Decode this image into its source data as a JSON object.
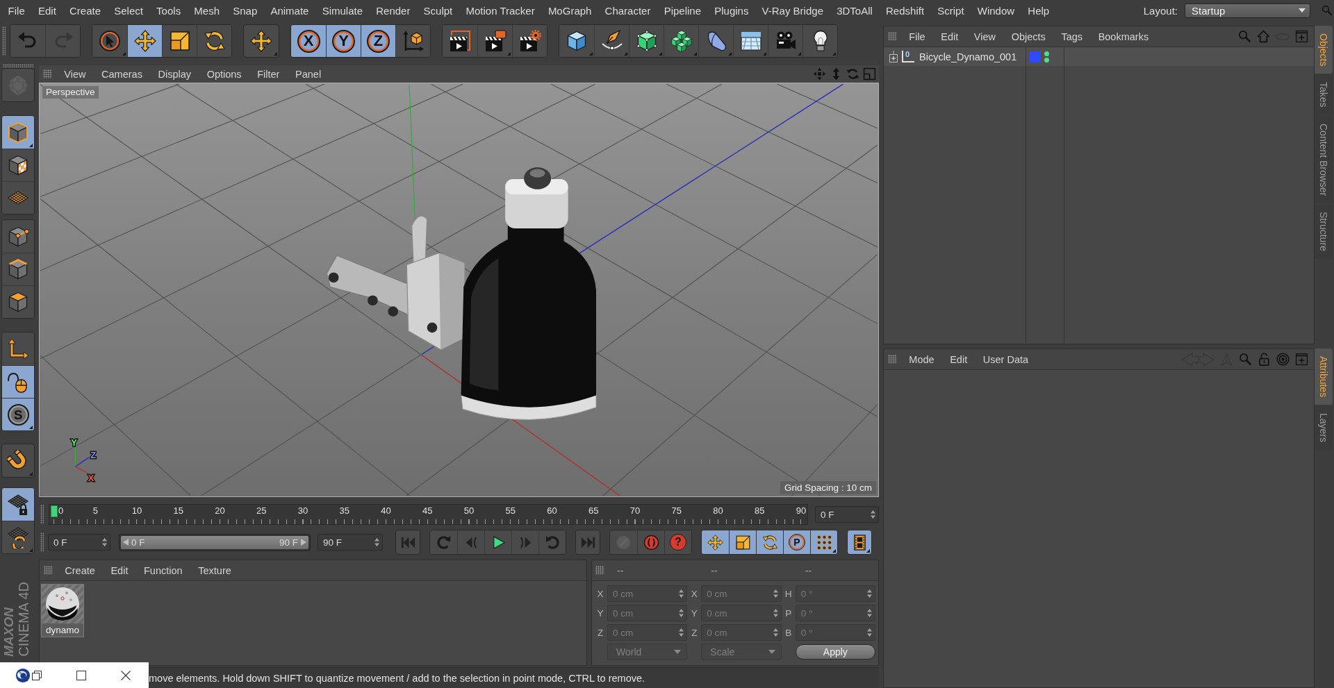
{
  "menu_bar": {
    "items": [
      "File",
      "Edit",
      "Create",
      "Select",
      "Tools",
      "Mesh",
      "Snap",
      "Animate",
      "Simulate",
      "Render",
      "Sculpt",
      "Motion Tracker",
      "MoGraph",
      "Character",
      "Pipeline",
      "Plugins",
      "V-Ray Bridge",
      "3DToAll",
      "Redshift",
      "Script",
      "Window",
      "Help"
    ],
    "layout_label": "Layout:",
    "layout_value": "Startup"
  },
  "toolbar": [
    [
      {
        "kind": "undo",
        "selected": false,
        "disabled": false,
        "menu": false
      },
      {
        "kind": "redo",
        "selected": false,
        "disabled": true,
        "menu": false
      }
    ],
    [
      {
        "kind": "select",
        "selected": false,
        "disabled": false,
        "menu": true
      },
      {
        "kind": "move",
        "selected": true,
        "disabled": false,
        "menu": false
      },
      {
        "kind": "scale",
        "selected": false,
        "disabled": false,
        "menu": false
      },
      {
        "kind": "rotate",
        "selected": false,
        "disabled": false,
        "menu": false
      }
    ],
    [
      {
        "kind": "transform",
        "selected": false,
        "disabled": false,
        "menu": true
      }
    ],
    [
      {
        "kind": "xaxis",
        "label": "X",
        "selected": true,
        "disabled": false,
        "menu": false
      },
      {
        "kind": "yaxis",
        "label": "Y",
        "selected": true,
        "disabled": false,
        "menu": false
      },
      {
        "kind": "zaxis",
        "label": "Z",
        "selected": true,
        "disabled": false,
        "menu": false
      },
      {
        "kind": "coords",
        "selected": false,
        "disabled": false,
        "menu": false
      }
    ],
    [
      {
        "kind": "renderview",
        "selected": false,
        "disabled": false,
        "menu": false
      },
      {
        "kind": "render",
        "selected": false,
        "disabled": false,
        "menu": true
      },
      {
        "kind": "rendersettings",
        "selected": false,
        "disabled": false,
        "menu": false
      }
    ],
    [
      {
        "kind": "cube",
        "selected": false,
        "disabled": false,
        "menu": true
      },
      {
        "kind": "pen",
        "selected": false,
        "disabled": false,
        "menu": true
      },
      {
        "kind": "subdivide",
        "selected": false,
        "disabled": false,
        "menu": true
      },
      {
        "kind": "cloner",
        "selected": false,
        "disabled": false,
        "menu": true
      },
      {
        "kind": "bend",
        "selected": false,
        "disabled": false,
        "menu": true
      },
      {
        "kind": "floor",
        "selected": false,
        "disabled": false,
        "menu": true
      },
      {
        "kind": "camera",
        "selected": false,
        "disabled": false,
        "menu": true
      },
      {
        "kind": "light",
        "selected": false,
        "disabled": false,
        "menu": true
      }
    ]
  ],
  "tool_column": [
    [
      {
        "kind": "editable",
        "selected": false,
        "disabled": true,
        "menu": false
      }
    ],
    [
      {
        "kind": "model",
        "selected": true,
        "disabled": false,
        "menu": true
      },
      {
        "kind": "texture",
        "selected": false,
        "disabled": false,
        "menu": false
      },
      {
        "kind": "workplane",
        "selected": false,
        "disabled": false,
        "menu": false
      }
    ],
    [
      {
        "kind": "points",
        "selected": false,
        "disabled": false,
        "menu": false
      },
      {
        "kind": "edges",
        "selected": false,
        "disabled": false,
        "menu": false
      },
      {
        "kind": "polygons",
        "selected": false,
        "disabled": false,
        "menu": false
      }
    ],
    [
      {
        "kind": "axis",
        "selected": false,
        "disabled": false,
        "menu": false
      },
      {
        "kind": "tweak",
        "selected": true,
        "disabled": false,
        "menu": false
      },
      {
        "kind": "solo",
        "label": "S",
        "selected": true,
        "disabled": false,
        "menu": true
      }
    ],
    [
      {
        "kind": "snap",
        "selected": false,
        "disabled": false,
        "menu": true
      }
    ],
    [
      {
        "kind": "lockplane",
        "selected": true,
        "disabled": false,
        "menu": false
      },
      {
        "kind": "alignplane",
        "selected": false,
        "disabled": false,
        "menu": true
      }
    ]
  ],
  "logo": {
    "brand": "MAXON",
    "product": "CINEMA 4D"
  },
  "viewport": {
    "menu": [
      "View",
      "Cameras",
      "Display",
      "Options",
      "Filter",
      "Panel"
    ],
    "camera": "Perspective",
    "grid_spacing": "Grid Spacing : 10 cm",
    "axis_labels": [
      "Y",
      "Z",
      "X"
    ]
  },
  "timeline": {
    "labels": [
      "0",
      "5",
      "10",
      "15",
      "20",
      "25",
      "30",
      "35",
      "40",
      "45",
      "50",
      "55",
      "60",
      "65",
      "70",
      "75",
      "80",
      "85",
      "90"
    ],
    "playhead": {
      "level": 0
    },
    "frame_field": "0 F"
  },
  "transport": {
    "start_field": "0 F",
    "range": {
      "start": "0 F",
      "end": "90 F",
      "level": 1
    },
    "end_field": "90 F",
    "buttons": [
      [
        {
          "kind": "first",
          "selected": false,
          "disabled": false,
          "menu": false
        }
      ],
      [
        {
          "kind": "prevkey",
          "selected": false,
          "disabled": false,
          "menu": false
        },
        {
          "kind": "prevframe",
          "selected": false,
          "disabled": false,
          "menu": false
        },
        {
          "kind": "play",
          "selected": false,
          "disabled": false,
          "menu": false
        },
        {
          "kind": "nextframe",
          "selected": false,
          "disabled": false,
          "menu": false
        },
        {
          "kind": "nextkey",
          "selected": false,
          "disabled": false,
          "menu": false
        }
      ],
      [
        {
          "kind": "last",
          "selected": false,
          "disabled": false,
          "menu": false
        }
      ],
      [
        {
          "kind": "record",
          "selected": false,
          "disabled": true,
          "menu": false
        },
        {
          "kind": "autokey",
          "selected": false,
          "disabled": false,
          "menu": false
        },
        {
          "kind": "keyselect",
          "label": "?",
          "selected": false,
          "disabled": false,
          "menu": false
        }
      ],
      [
        {
          "kind": "movekey",
          "selected": true,
          "disabled": false,
          "menu": false
        },
        {
          "kind": "scalekey",
          "selected": true,
          "disabled": false,
          "menu": false
        },
        {
          "kind": "rotatekey",
          "selected": true,
          "disabled": false,
          "menu": false
        },
        {
          "kind": "paramkey",
          "label": "P",
          "selected": true,
          "disabled": false,
          "menu": false
        },
        {
          "kind": "plakey",
          "selected": true,
          "disabled": false,
          "menu": true
        }
      ],
      [
        {
          "kind": "timeline",
          "selected": true,
          "disabled": false,
          "menu": true
        }
      ]
    ]
  },
  "materials": {
    "menu": [
      "Create",
      "Edit",
      "Function",
      "Texture"
    ],
    "items": [
      {
        "name": "dynamo"
      }
    ]
  },
  "coordinates": {
    "headers": [
      "--",
      "--",
      "--"
    ],
    "disabled": true,
    "rows": [
      [
        {
          "label": "X",
          "value": "0 cm"
        },
        {
          "label": "X",
          "value": "0 cm"
        },
        {
          "label": "H",
          "value": "0 °"
        }
      ],
      [
        {
          "label": "Y",
          "value": "0 cm"
        },
        {
          "label": "Y",
          "value": "0 cm"
        },
        {
          "label": "P",
          "value": "0 °"
        }
      ],
      [
        {
          "label": "Z",
          "value": "0 cm"
        },
        {
          "label": "Z",
          "value": "0 cm"
        },
        {
          "label": "B",
          "value": "0 °"
        }
      ]
    ],
    "dropdowns": [
      "World",
      "Scale"
    ],
    "apply": "Apply"
  },
  "status_bar": {
    "text": "move elements. Hold down SHIFT to quantize movement / add to the selection in point mode, CTRL to remove."
  },
  "objects": {
    "menu": [
      "File",
      "Edit",
      "View",
      "Objects",
      "Tags",
      "Bookmarks"
    ],
    "tools": [
      {
        "kind": "search",
        "disabled": false
      },
      {
        "kind": "home",
        "disabled": false
      },
      {
        "kind": "eye",
        "disabled": true
      },
      {
        "kind": "newwin",
        "disabled": false
      }
    ],
    "tree": [
      {
        "name": "Bicycle_Dynamo_001",
        "type_label": "0",
        "expanded": false,
        "color": "#2f4bff",
        "editor_visible": true,
        "render_visible": true
      }
    ]
  },
  "attributes": {
    "menu": [
      "Mode",
      "Edit",
      "User Data"
    ],
    "tools": [
      {
        "kind": "back",
        "disabled": true
      },
      {
        "kind": "up",
        "disabled": true
      },
      {
        "kind": "search",
        "disabled": false
      },
      {
        "kind": "lock",
        "disabled": false
      },
      {
        "kind": "target",
        "disabled": false
      },
      {
        "kind": "newwin",
        "disabled": false
      }
    ]
  },
  "side_tabs": {
    "upper": [
      {
        "label": "Objects",
        "selected": true
      },
      {
        "label": "Takes",
        "selected": false
      },
      {
        "label": "Content Browser",
        "selected": false
      },
      {
        "label": "Structure",
        "selected": false
      }
    ],
    "lower": [
      {
        "label": "Attributes",
        "selected": true
      },
      {
        "label": "Layers",
        "selected": false
      }
    ]
  }
}
